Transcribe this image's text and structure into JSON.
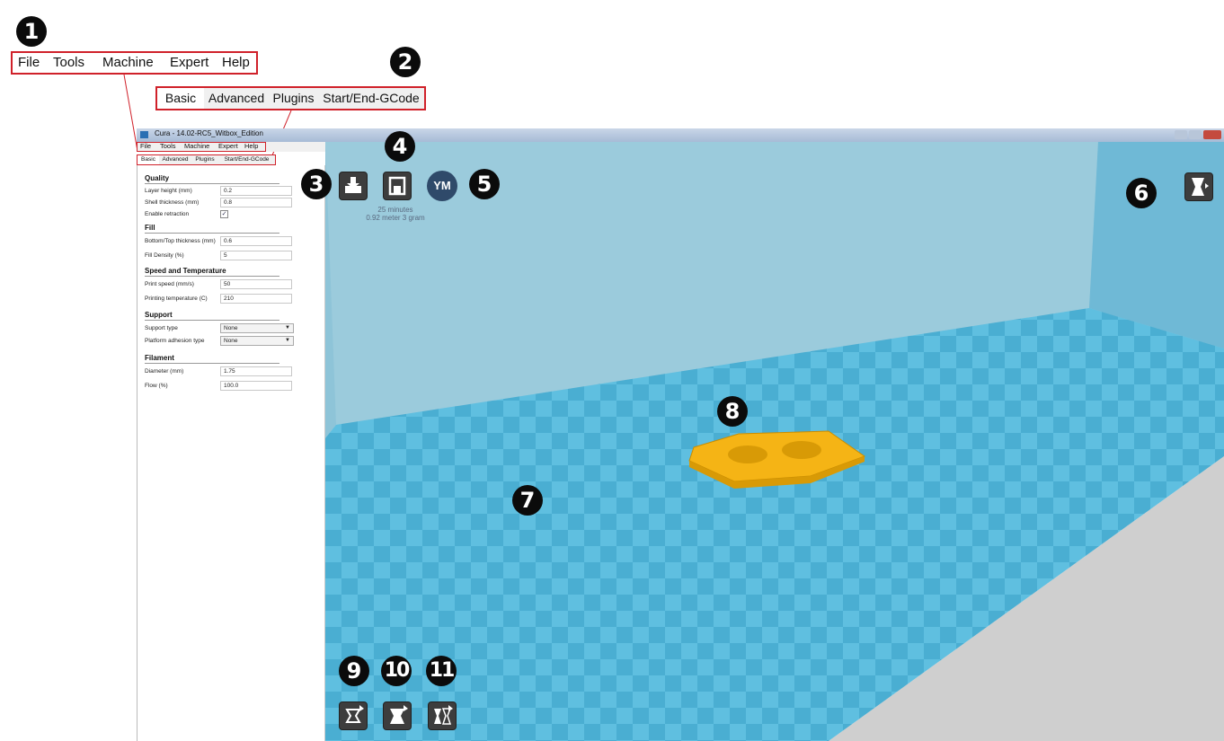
{
  "zoom_menu": {
    "items": [
      "File",
      "Tools",
      "Machine",
      "Expert",
      "Help"
    ]
  },
  "zoom_tabs": {
    "items": [
      "Basic",
      "Advanced",
      "Plugins",
      "Start/End-GCode"
    ],
    "active": "Basic"
  },
  "window": {
    "title": "Cura - 14.02-RC5_Witbox_Edition"
  },
  "app_menu": {
    "items": [
      "File",
      "Tools",
      "Machine",
      "Expert",
      "Help"
    ]
  },
  "app_tabs": {
    "items": [
      "Basic",
      "Advanced",
      "Plugins",
      "Start/End-GCode"
    ],
    "active": "Basic"
  },
  "settings": {
    "quality": {
      "title": "Quality",
      "layer_height": {
        "label": "Layer height (mm)",
        "value": "0.2"
      },
      "shell_thickness": {
        "label": "Shell thickness (mm)",
        "value": "0.8"
      },
      "enable_retraction": {
        "label": "Enable retraction",
        "checked": true
      }
    },
    "fill": {
      "title": "Fill",
      "bottom_top_thickness": {
        "label": "Bottom/Top thickness (mm)",
        "value": "0.6"
      },
      "fill_density": {
        "label": "Fill Density (%)",
        "value": "5"
      }
    },
    "speed": {
      "title": "Speed and Temperature",
      "print_speed": {
        "label": "Print speed (mm/s)",
        "value": "50"
      },
      "printing_temperature": {
        "label": "Printing temperature (C)",
        "value": "210"
      }
    },
    "support": {
      "title": "Support",
      "support_type": {
        "label": "Support type",
        "value": "None"
      },
      "platform_adhesion": {
        "label": "Platform adhesion type",
        "value": "None"
      }
    },
    "filament": {
      "title": "Filament",
      "diameter": {
        "label": "Diameter (mm)",
        "value": "1.75"
      },
      "flow": {
        "label": "Flow (%)",
        "value": "100.0"
      }
    }
  },
  "print_info": {
    "time": "25 minutes",
    "material": "0.92 meter 3 gram"
  },
  "ym_button": {
    "label": "YM"
  },
  "callouts": [
    "1",
    "2",
    "3",
    "4",
    "5",
    "6",
    "7",
    "8",
    "9",
    "10",
    "11"
  ],
  "colors": {
    "callout_bg": "#0b0b0b",
    "highlight_red": "#d0212a",
    "bed_blue": "#5fbfe0",
    "object_yellow": "#f5b415",
    "wall_blue": "#8ec4d8"
  },
  "icons": {
    "load": "load-model-icon",
    "save": "save-toolpath-icon",
    "view_mode": "view-mode-icon",
    "rotate": "rotate-icon",
    "scale": "scale-icon",
    "mirror": "mirror-icon"
  }
}
